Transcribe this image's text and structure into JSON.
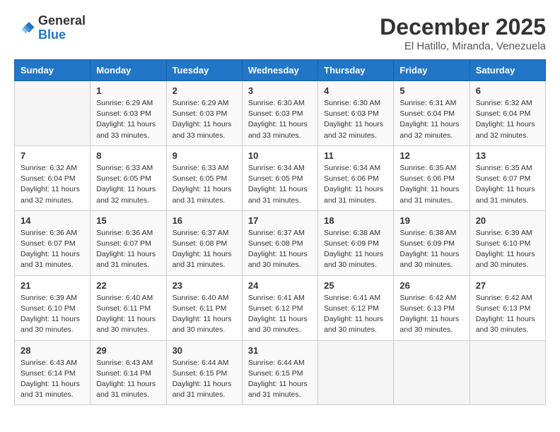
{
  "logo": {
    "general": "General",
    "blue": "Blue"
  },
  "title": "December 2025",
  "subtitle": "El Hatillo, Miranda, Venezuela",
  "weekdays": [
    "Sunday",
    "Monday",
    "Tuesday",
    "Wednesday",
    "Thursday",
    "Friday",
    "Saturday"
  ],
  "weeks": [
    [
      {
        "day": "",
        "empty": true
      },
      {
        "day": "1",
        "sunrise": "Sunrise: 6:29 AM",
        "sunset": "Sunset: 6:03 PM",
        "daylight": "Daylight: 11 hours and 33 minutes."
      },
      {
        "day": "2",
        "sunrise": "Sunrise: 6:29 AM",
        "sunset": "Sunset: 6:03 PM",
        "daylight": "Daylight: 11 hours and 33 minutes."
      },
      {
        "day": "3",
        "sunrise": "Sunrise: 6:30 AM",
        "sunset": "Sunset: 6:03 PM",
        "daylight": "Daylight: 11 hours and 33 minutes."
      },
      {
        "day": "4",
        "sunrise": "Sunrise: 6:30 AM",
        "sunset": "Sunset: 6:03 PM",
        "daylight": "Daylight: 11 hours and 32 minutes."
      },
      {
        "day": "5",
        "sunrise": "Sunrise: 6:31 AM",
        "sunset": "Sunset: 6:04 PM",
        "daylight": "Daylight: 11 hours and 32 minutes."
      },
      {
        "day": "6",
        "sunrise": "Sunrise: 6:32 AM",
        "sunset": "Sunset: 6:04 PM",
        "daylight": "Daylight: 11 hours and 32 minutes."
      }
    ],
    [
      {
        "day": "7",
        "sunrise": "Sunrise: 6:32 AM",
        "sunset": "Sunset: 6:04 PM",
        "daylight": "Daylight: 11 hours and 32 minutes."
      },
      {
        "day": "8",
        "sunrise": "Sunrise: 6:33 AM",
        "sunset": "Sunset: 6:05 PM",
        "daylight": "Daylight: 11 hours and 32 minutes."
      },
      {
        "day": "9",
        "sunrise": "Sunrise: 6:33 AM",
        "sunset": "Sunset: 6:05 PM",
        "daylight": "Daylight: 11 hours and 31 minutes."
      },
      {
        "day": "10",
        "sunrise": "Sunrise: 6:34 AM",
        "sunset": "Sunset: 6:05 PM",
        "daylight": "Daylight: 11 hours and 31 minutes."
      },
      {
        "day": "11",
        "sunrise": "Sunrise: 6:34 AM",
        "sunset": "Sunset: 6:06 PM",
        "daylight": "Daylight: 11 hours and 31 minutes."
      },
      {
        "day": "12",
        "sunrise": "Sunrise: 6:35 AM",
        "sunset": "Sunset: 6:06 PM",
        "daylight": "Daylight: 11 hours and 31 minutes."
      },
      {
        "day": "13",
        "sunrise": "Sunrise: 6:35 AM",
        "sunset": "Sunset: 6:07 PM",
        "daylight": "Daylight: 11 hours and 31 minutes."
      }
    ],
    [
      {
        "day": "14",
        "sunrise": "Sunrise: 6:36 AM",
        "sunset": "Sunset: 6:07 PM",
        "daylight": "Daylight: 11 hours and 31 minutes."
      },
      {
        "day": "15",
        "sunrise": "Sunrise: 6:36 AM",
        "sunset": "Sunset: 6:07 PM",
        "daylight": "Daylight: 11 hours and 31 minutes."
      },
      {
        "day": "16",
        "sunrise": "Sunrise: 6:37 AM",
        "sunset": "Sunset: 6:08 PM",
        "daylight": "Daylight: 11 hours and 31 minutes."
      },
      {
        "day": "17",
        "sunrise": "Sunrise: 6:37 AM",
        "sunset": "Sunset: 6:08 PM",
        "daylight": "Daylight: 11 hours and 30 minutes."
      },
      {
        "day": "18",
        "sunrise": "Sunrise: 6:38 AM",
        "sunset": "Sunset: 6:09 PM",
        "daylight": "Daylight: 11 hours and 30 minutes."
      },
      {
        "day": "19",
        "sunrise": "Sunrise: 6:38 AM",
        "sunset": "Sunset: 6:09 PM",
        "daylight": "Daylight: 11 hours and 30 minutes."
      },
      {
        "day": "20",
        "sunrise": "Sunrise: 6:39 AM",
        "sunset": "Sunset: 6:10 PM",
        "daylight": "Daylight: 11 hours and 30 minutes."
      }
    ],
    [
      {
        "day": "21",
        "sunrise": "Sunrise: 6:39 AM",
        "sunset": "Sunset: 6:10 PM",
        "daylight": "Daylight: 11 hours and 30 minutes."
      },
      {
        "day": "22",
        "sunrise": "Sunrise: 6:40 AM",
        "sunset": "Sunset: 6:11 PM",
        "daylight": "Daylight: 11 hours and 30 minutes."
      },
      {
        "day": "23",
        "sunrise": "Sunrise: 6:40 AM",
        "sunset": "Sunset: 6:11 PM",
        "daylight": "Daylight: 11 hours and 30 minutes."
      },
      {
        "day": "24",
        "sunrise": "Sunrise: 6:41 AM",
        "sunset": "Sunset: 6:12 PM",
        "daylight": "Daylight: 11 hours and 30 minutes."
      },
      {
        "day": "25",
        "sunrise": "Sunrise: 6:41 AM",
        "sunset": "Sunset: 6:12 PM",
        "daylight": "Daylight: 11 hours and 30 minutes."
      },
      {
        "day": "26",
        "sunrise": "Sunrise: 6:42 AM",
        "sunset": "Sunset: 6:13 PM",
        "daylight": "Daylight: 11 hours and 30 minutes."
      },
      {
        "day": "27",
        "sunrise": "Sunrise: 6:42 AM",
        "sunset": "Sunset: 6:13 PM",
        "daylight": "Daylight: 11 hours and 30 minutes."
      }
    ],
    [
      {
        "day": "28",
        "sunrise": "Sunrise: 6:43 AM",
        "sunset": "Sunset: 6:14 PM",
        "daylight": "Daylight: 11 hours and 31 minutes."
      },
      {
        "day": "29",
        "sunrise": "Sunrise: 6:43 AM",
        "sunset": "Sunset: 6:14 PM",
        "daylight": "Daylight: 11 hours and 31 minutes."
      },
      {
        "day": "30",
        "sunrise": "Sunrise: 6:44 AM",
        "sunset": "Sunset: 6:15 PM",
        "daylight": "Daylight: 11 hours and 31 minutes."
      },
      {
        "day": "31",
        "sunrise": "Sunrise: 6:44 AM",
        "sunset": "Sunset: 6:15 PM",
        "daylight": "Daylight: 11 hours and 31 minutes."
      },
      {
        "day": "",
        "empty": true
      },
      {
        "day": "",
        "empty": true
      },
      {
        "day": "",
        "empty": true
      }
    ]
  ]
}
